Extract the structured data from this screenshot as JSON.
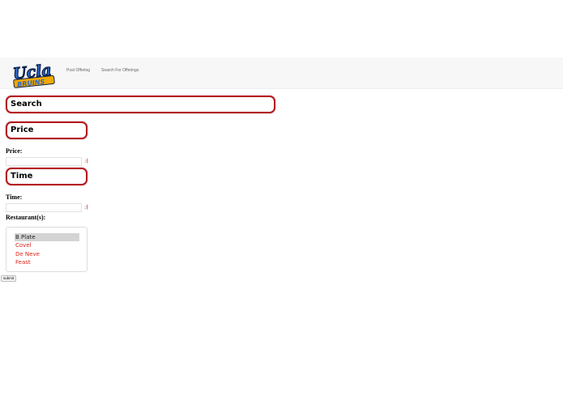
{
  "header": {
    "logo_text": "UCLA BRUINS",
    "nav": {
      "post_offering": "Post Offering",
      "search_for_offerings": "Search For Offerings"
    }
  },
  "form": {
    "search_heading": "Search",
    "price": {
      "heading": "Price",
      "label": "Price:",
      "value": "",
      "indicator": ":("
    },
    "time": {
      "heading": "Time",
      "label": "Time:",
      "value": "",
      "indicator": ":("
    },
    "restaurants": {
      "label": "Restaurant(s):",
      "options": [
        "B Plate",
        "Covel",
        "De Neve",
        "Feast"
      ],
      "selected": "B Plate"
    },
    "submit_label": "submit"
  },
  "colors": {
    "accent_red": "#b4141e",
    "option_red": "#e2231a",
    "selected_bg": "#d4d4d4",
    "navbar_bg": "#f7f7f7",
    "logo_blue": "#2d68c4",
    "logo_gold": "#f2a900"
  },
  "icons": {
    "logo": "ucla-bruins-logo"
  }
}
